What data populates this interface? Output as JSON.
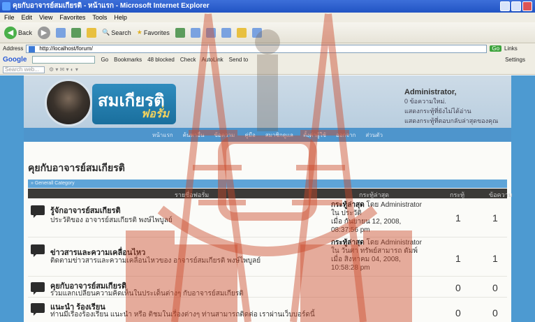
{
  "window": {
    "title": "คุยกับอาจารย์สมเกียรติ - หน้าแรก - Microsoft Internet Explorer"
  },
  "menu": [
    "File",
    "Edit",
    "View",
    "Favorites",
    "Tools",
    "Help"
  ],
  "toolbar": {
    "back": "Back",
    "search": "Search",
    "favorites": "Favorites"
  },
  "address": {
    "label": "Address",
    "url": "http://localhost/forum/",
    "go": "Go",
    "links": "Links"
  },
  "googlebar": {
    "logo": "Google",
    "go": "Go",
    "bookmarks": "Bookmarks",
    "blocked": "48 blocked",
    "check": "Check",
    "autolink": "AutoLink",
    "sendto": "Send to",
    "settings": "Settings"
  },
  "searchbar": {
    "placeholder": "Search web..."
  },
  "site": {
    "logo": "สมเกียรติ",
    "logo_sub": "ฟอรั่ม",
    "user_name": "Administrator,",
    "user_line1": "0 ข้อความใหม่.",
    "user_line2": "แสดงกระทู้ที่ยังไม่ได้อ่าน",
    "user_line3": "แสดงกระทู้ที่ตอบกลับล่าสุดของคุณ",
    "nav": [
      "หน้าแรก",
      "ค้นหาอื่น",
      "ข้อความ",
      "คู่มือ",
      "สมาชิกดูแล",
      "ตั้งค่าผู้ใช้",
      "ออกจาก",
      "ส่วนตัว"
    ]
  },
  "main": {
    "heading": "คุยกับอาจารย์สมเกียรติ",
    "category": "» Generall Category",
    "columns": [
      "รายชื่อฟอรั่ม",
      "กระทู้ล่าสุด",
      "กระทู้",
      "ข้อความ"
    ],
    "forums": [
      {
        "title": "รู้จักอาจารย์สมเกียรติ",
        "desc": "ประวัติของ อาจารย์สมเกียรติ พงษ์ไพบูลย์",
        "last1": "กระทู้ล่าสุด",
        "last_by": "โดย Administrator",
        "last2": "ใน ประวัติ",
        "last3": "เมื่อ กันยายน 12, 2008,",
        "last4": "08:37:56 pm",
        "topics": "1",
        "posts": "1"
      },
      {
        "title": "ข่าวสารและความเคลื่อนไหว",
        "desc": "ติดตามข่าวสารและความเคลื่อนไหวของ อาจารย์สมเกียรติ พงษ์ไพบูลย์",
        "last1": "กระทู้ล่าสุด",
        "last_by": "โดย Administrator",
        "last2": "ใน วันศา ทรัพย์สามารถ ดัมพ์",
        "last3": "เมื่อ สิงหาคม 04, 2008,",
        "last4": "10:58:28 pm",
        "topics": "1",
        "posts": "1"
      },
      {
        "title": "คุยกับอาจารย์สมเกียรติ",
        "desc": "ร่วมแลกเปลี่ยนความคิดเห็นในประเด็นต่างๆ กับอาจารย์สมเกียรติ",
        "topics": "0",
        "posts": "0"
      },
      {
        "title": "แนะนำ ร้องเรียน",
        "desc": "ท่านมีเรื่องร้องเรียน แนะนำ หรือ ติชมในเรื่องต่างๆ ท่านสามารถติดต่อ เราผ่านเว็บบอร์ดนี้",
        "topics": "0",
        "posts": "0"
      }
    ]
  },
  "colors": {
    "titlebar": "#2154c4",
    "page_bg": "#4d9ad1",
    "nav": "#4e95cc",
    "thead": "#3b3a38",
    "watermark": "#c94a2a"
  }
}
